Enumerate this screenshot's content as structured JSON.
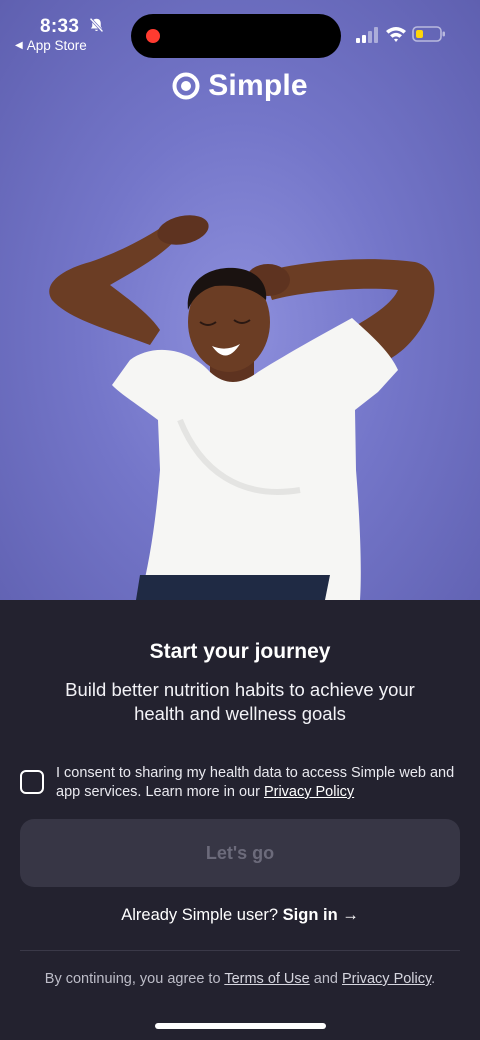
{
  "status_bar": {
    "time": "8:33",
    "back_app": "App Store",
    "icons": [
      "bell-slash-icon",
      "signal-icon",
      "wifi-icon",
      "battery-icon"
    ]
  },
  "brand": {
    "name": "Simple",
    "icon": "simple-logo-icon"
  },
  "hero": {
    "bg_color": "#7476c9"
  },
  "content": {
    "headline": "Start your journey",
    "subhead": "Build better nutrition habits to achieve your health and wellness goals",
    "consent": {
      "checked": false,
      "text": "I consent to sharing my health data to access Simple web and app services. Learn more in our",
      "link": "Privacy Policy"
    },
    "cta_label": "Let's go",
    "signin": {
      "prompt": "Already Simple user?",
      "link": "Sign in",
      "arrow": "→"
    },
    "legal": {
      "prefix": "By continuing, you agree to",
      "terms": "Terms of Use",
      "and": "and",
      "privacy": "Privacy Policy",
      "suffix": "."
    }
  },
  "colors": {
    "background": "#23222f",
    "button_disabled": "#373645",
    "button_text_disabled": "#6c6b7b",
    "recording_dot": "#ff3b30"
  }
}
